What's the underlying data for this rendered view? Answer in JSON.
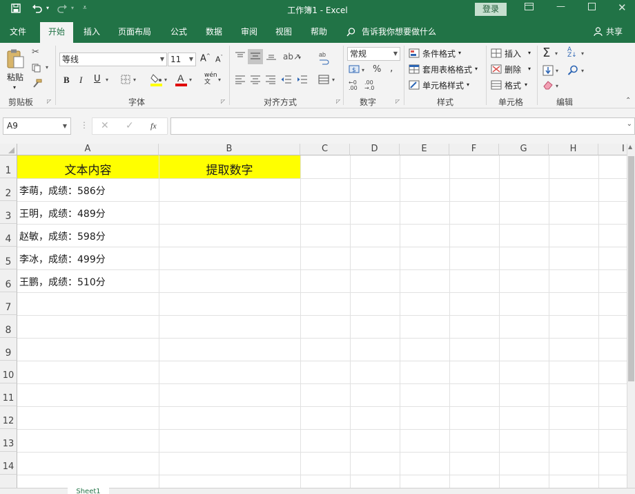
{
  "titlebar": {
    "title": "工作簿1 - Excel",
    "login_label": "登录",
    "save_icon": "save-icon",
    "undo_icon": "undo-icon",
    "redo_icon": "redo-icon"
  },
  "tabs": [
    {
      "label": "文件"
    },
    {
      "label": "开始"
    },
    {
      "label": "插入"
    },
    {
      "label": "页面布局"
    },
    {
      "label": "公式"
    },
    {
      "label": "数据"
    },
    {
      "label": "审阅"
    },
    {
      "label": "视图"
    },
    {
      "label": "帮助"
    }
  ],
  "tell_me": "告诉我你想要做什么",
  "share_label": "共享",
  "ribbon": {
    "clipboard": {
      "paste_label": "粘贴",
      "group_label": "剪贴板"
    },
    "font": {
      "font_name": "等线",
      "font_size": "11",
      "group_label": "字体"
    },
    "alignment": {
      "group_label": "对齐方式"
    },
    "number": {
      "format": "常规",
      "group_label": "数字"
    },
    "styles": {
      "conditional": "条件格式",
      "table_format": "套用表格格式",
      "cell_styles": "单元格样式",
      "group_label": "样式"
    },
    "cells": {
      "insert": "插入",
      "delete": "删除",
      "format": "格式",
      "group_label": "单元格"
    },
    "editing": {
      "group_label": "编辑"
    }
  },
  "formula_bar": {
    "name_box": "A9",
    "fx_label": "fx",
    "content": ""
  },
  "sheet": {
    "columns": [
      "A",
      "B",
      "C",
      "D",
      "E",
      "F",
      "G",
      "H",
      "I"
    ],
    "rows": [
      "1",
      "2",
      "3",
      "4",
      "5",
      "6",
      "7",
      "8",
      "9",
      "10",
      "11",
      "12",
      "13",
      "14"
    ],
    "header_a": "文本内容",
    "header_b": "提取数字",
    "header_fill": "#ffff00",
    "data_a": [
      "李萌，成绩：586分",
      "王明，成绩：489分",
      "赵敏，成绩：598分",
      "李冰，成绩：499分",
      "王鹏，成绩：510分"
    ]
  },
  "sheet_tab": "Sheet1",
  "colors": {
    "brand": "#217346",
    "ribbon_bg": "#f3f3f3"
  }
}
